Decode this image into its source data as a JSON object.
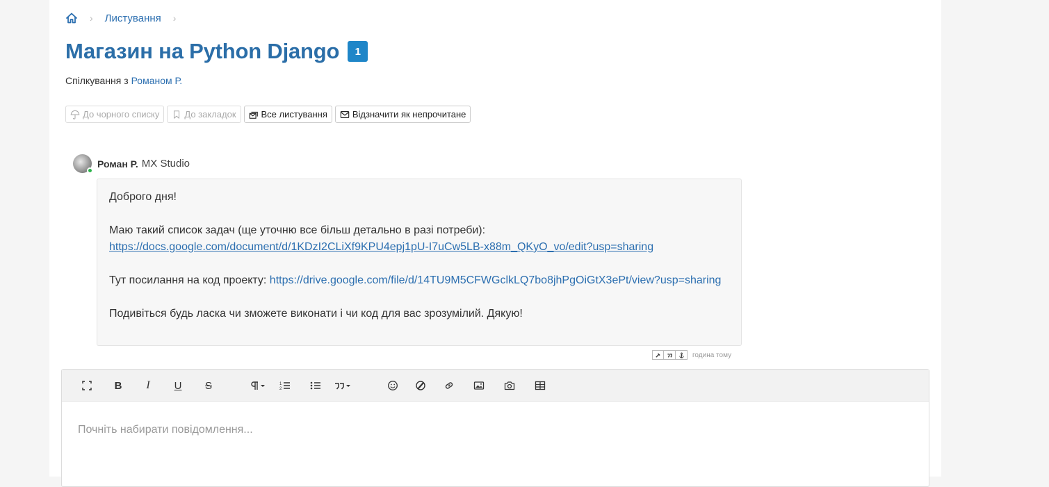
{
  "breadcrumb": {
    "home_icon": "home-icon",
    "items": [
      "Листування"
    ]
  },
  "title": "Магазин на Python Django",
  "badge_count": "1",
  "subtitle": {
    "prefix": "Спілкування з ",
    "person": "Романом Р."
  },
  "actions": {
    "blacklist": "До чорного списку",
    "bookmark": "До закладок",
    "all_conversations": "Все листування",
    "mark_unread": "Відзначити як непрочитане"
  },
  "message": {
    "author": "Роман Р.",
    "company": "MX Studio",
    "greeting": "Доброго дня!",
    "task_intro": "Маю такий список задач (ще уточню все більш детально в разі потреби):",
    "docs_link": "https://docs.google.com/document/d/1KDzI2CLiXf9KPU4epj1pU-I7uCw5LB-x88m_QKyO_vo/edit?usp=sharing",
    "code_prefix": "Тут посилання на код проекту: ",
    "drive_link": "https://drive.google.com/file/d/14TU9M5CFWGclkLQ7bo8jhPgOiGtX3ePt/view?usp=sharing",
    "closing": "Подивіться будь ласка чи зможете виконати і чи код для вас зрозумілий. Дякую!",
    "timestamp": "година тому"
  },
  "editor": {
    "placeholder": "Почніть набирати повідомлення...",
    "toolbar_icons": [
      "fullscreen-icon",
      "bold-icon",
      "italic-icon",
      "underline-icon",
      "strikethrough-icon",
      "paragraph-icon",
      "ordered-list-icon",
      "unordered-list-icon",
      "quote-icon",
      "emoji-icon",
      "style-icon",
      "link-icon",
      "image-icon",
      "camera-icon",
      "table-icon"
    ],
    "bold": "B",
    "italic": "I",
    "underline": "U",
    "strike": "S"
  },
  "colors": {
    "accent": "#2b6ea8",
    "badge": "#1f86c8",
    "link": "#2c6fb0",
    "online": "#2bb34a"
  }
}
